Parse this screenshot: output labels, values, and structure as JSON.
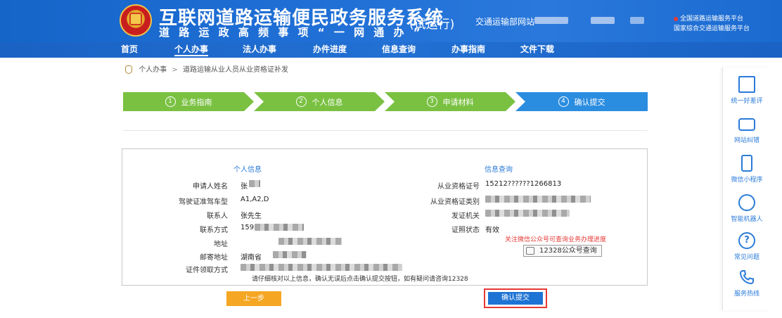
{
  "header": {
    "title": "互联网道路运输便民政务服务系统",
    "trial": "(试运行)",
    "slogan": "道 路 运 政 高 频 事 项 “ 一 网 通 办 ”",
    "link_label": "交通运输部网站",
    "notice_line1": "全国道路运输服务平台",
    "notice_line2": "国家综合交通运输服务平台"
  },
  "nav": {
    "items": [
      {
        "label": "首页"
      },
      {
        "label": "个人办事"
      },
      {
        "label": "法人办事"
      },
      {
        "label": "办件进度"
      },
      {
        "label": "信息查询"
      },
      {
        "label": "办事指南"
      },
      {
        "label": "文件下载"
      }
    ]
  },
  "breadcrumb": {
    "root": "个人办事",
    "current": "道路运输从业人员从业资格证补发"
  },
  "steps": [
    {
      "num": "1",
      "label": "业务指南"
    },
    {
      "num": "2",
      "label": "个人信息"
    },
    {
      "num": "3",
      "label": "申请材料"
    },
    {
      "num": "4",
      "label": "确认提交"
    }
  ],
  "panel": {
    "left_title": "个人信息",
    "right_title": "信息查询",
    "left_rows": [
      {
        "label": "申请人姓名",
        "value": "张"
      },
      {
        "label": "驾驶证准驾车型",
        "value": "A1,A2,D"
      },
      {
        "label": "联系人",
        "value": "张先生"
      },
      {
        "label": "联系方式",
        "value": "159"
      },
      {
        "label": "地址",
        "value": ""
      },
      {
        "label": "邮寄地址",
        "value": "湖南省"
      },
      {
        "label": "证件领取方式",
        "value": ""
      }
    ],
    "right_rows": [
      {
        "label": "从业资格证号",
        "value": "15212??????1266813"
      },
      {
        "label": "从业资格证类别",
        "value": ""
      },
      {
        "label": "发证机关",
        "value": ""
      },
      {
        "label": "证照状态",
        "value": "有效"
      }
    ],
    "notice": "关注微信公众号可查询业务办理进度",
    "badge": "12328公众号查询",
    "footer_note": "请仔细核对以上信息，确认无误后点击确认提交按钮，如有疑问请咨询12328"
  },
  "buttons": {
    "prev": "上一步",
    "confirm": "确认提交"
  },
  "sidebar": {
    "items": [
      {
        "label": "统一好差评",
        "icon": "rating-icon"
      },
      {
        "label": "网站纠错",
        "icon": "chat-icon"
      },
      {
        "label": "微信小程序",
        "icon": "phone-icon"
      },
      {
        "label": "智能机器人",
        "icon": "robot-icon"
      },
      {
        "label": "常见问题",
        "icon": "question-icon"
      },
      {
        "label": "服务热线",
        "icon": "telephone-icon"
      }
    ]
  },
  "colors": {
    "header_blue": "#1f6fd6",
    "step_done": "#7ac142",
    "step_current": "#2b8de0",
    "prev_button": "#f5a623",
    "confirm_button": "#1e73d4",
    "highlight_border": "#e53935"
  }
}
